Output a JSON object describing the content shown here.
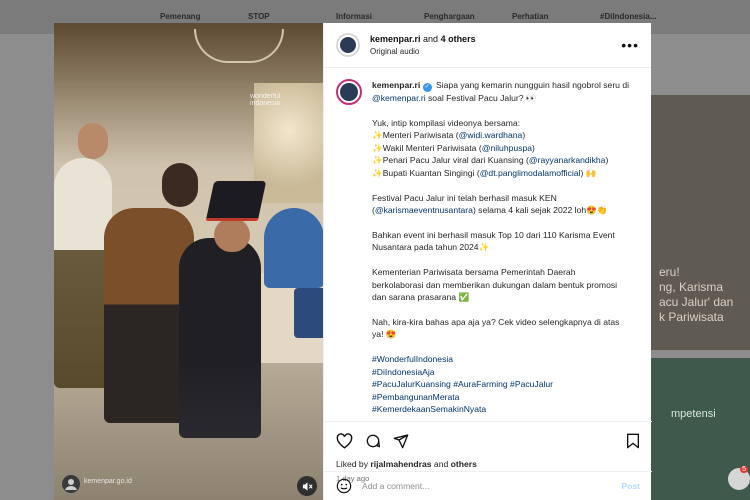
{
  "background": {
    "nav": [
      "Pemenang",
      "STOP",
      "Informasi",
      "Penghargaan",
      "Perhatian",
      "#DiIndonesia..."
    ],
    "card1_text": [
      "eru!",
      "ng, Karisma",
      "acu Jalur' dan",
      "k Pariwisata"
    ],
    "card2_text": "mpetensi",
    "badge_count": "5"
  },
  "media": {
    "logo_text": "wonderful indonesia",
    "watermark": "kemenpar.go.id"
  },
  "header": {
    "account": "kemenpar.ri",
    "and_text": " and ",
    "others": "4 others",
    "audio": "Original audio"
  },
  "caption": {
    "username": "kemenpar.ri",
    "intro": "Siapa yang kemarin nungguin hasil ngobrol seru di",
    "intro_handle": "@kemenpar.ri",
    "intro_end": " soal Festival Pacu Jalur? 👀",
    "p2_title": "Yuk, intip kompilasi videonya bersama:",
    "people": [
      {
        "role": "✨Menteri Pariwisata (",
        "handle": "@widi.wardhana",
        "end": ")"
      },
      {
        "role": "✨Wakil Menteri Pariwisata (",
        "handle": "@niluhpuspa",
        "end": ")"
      },
      {
        "role": "✨Penari Pacu Jalur viral dari Kuansing (",
        "handle": "@rayyanarkandikha",
        "end": ")"
      },
      {
        "role": "✨Bupati Kuantan Singingi (",
        "handle": "@dt.panglimodalamofficial",
        "end": ") 🙌"
      }
    ],
    "p3a": "Festival Pacu Jalur ini telah berhasil masuk KEN",
    "p3_handle": "@karismaeventnusantara",
    "p3b": ") selama 4 kali sejak 2022 loh😍👏",
    "p4a": "Bahkan event ini berhasil masuk Top 10 dari 110 Karisma Event",
    "p4b": "Nusantara pada tahun 2024✨",
    "p5a": "Kementerian Pariwisata bersama Pemerintah Daerah",
    "p5b": "berkolaborasi dan memberikan dukungan dalam bentuk promosi",
    "p5c": "dan sarana prasarana ✅",
    "p6a": "Nah, kira-kira bahas apa aja ya? Cek video selengkapnya di atas",
    "p6b": "ya! 😍",
    "tags": [
      "#WonderfulIndonesia",
      "#DiIndonesiaAja",
      "#PacuJalurKuansing #AuraFarming #PacuJalur",
      "#PembangunanMerata",
      "#KemerdekaanSemakinNyata"
    ]
  },
  "likes": {
    "prefix": "Liked by ",
    "user": "rijalmahendras",
    "mid": " and ",
    "others": "others"
  },
  "time": "1 day ago",
  "comment": {
    "placeholder": "Add a comment...",
    "post": "Post"
  }
}
